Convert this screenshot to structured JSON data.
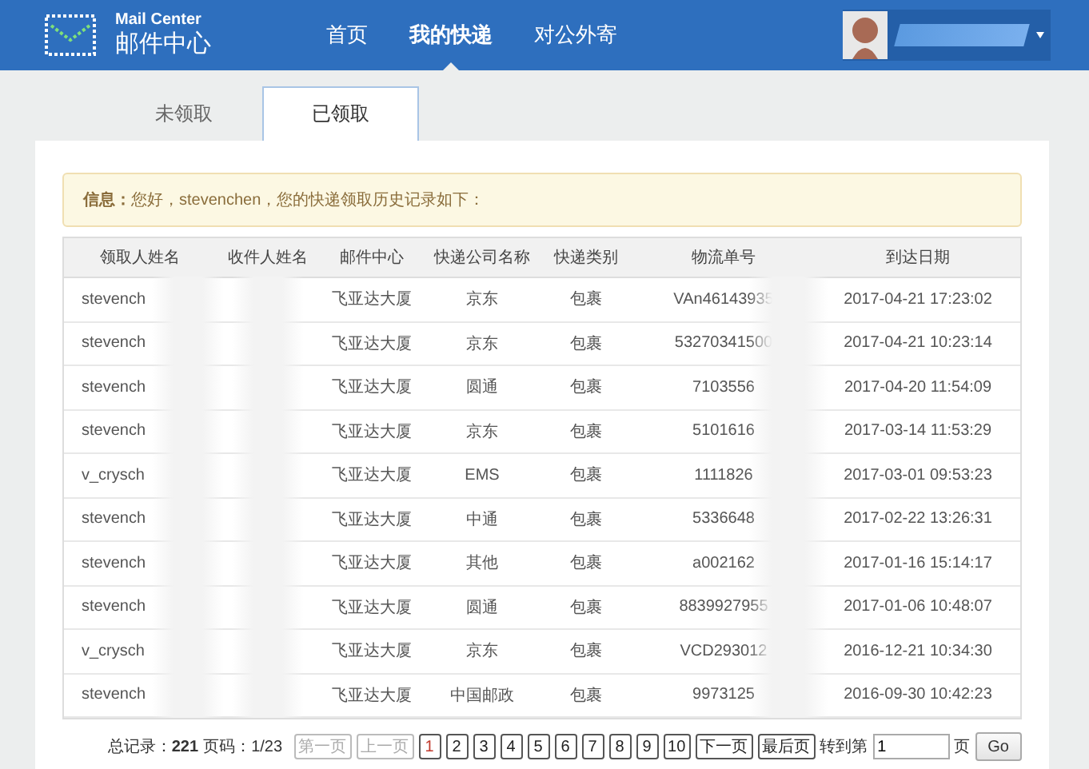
{
  "logo": {
    "title": "Mail Center",
    "subtitle": "邮件中心"
  },
  "nav": [
    {
      "label": "首页",
      "selected": false
    },
    {
      "label": "我的快递",
      "selected": true
    },
    {
      "label": "对公外寄",
      "selected": false
    }
  ],
  "tabs": [
    {
      "label": "未领取",
      "selected": false
    },
    {
      "label": "已领取",
      "selected": true
    }
  ],
  "info": {
    "label": "信息：",
    "text": "您好，stevenchen，您的快递领取历史记录如下："
  },
  "table": {
    "columns": [
      "领取人姓名",
      "收件人姓名",
      "邮件中心",
      "快递公司名称",
      "快递类别",
      "物流单号",
      "到达日期"
    ],
    "rows": [
      [
        "stevench",
        "",
        "飞亚达大厦",
        "京东",
        "包裹",
        "VAn46143935",
        "2017-04-21 17:23:02"
      ],
      [
        "stevench",
        "",
        "飞亚达大厦",
        "京东",
        "包裹",
        "53270341500",
        "2017-04-21 10:23:14"
      ],
      [
        "stevench",
        "",
        "飞亚达大厦",
        "圆通",
        "包裹",
        "7103556",
        "2017-04-20 11:54:09"
      ],
      [
        "stevench",
        "",
        "飞亚达大厦",
        "京东",
        "包裹",
        "5101616",
        "2017-03-14 11:53:29"
      ],
      [
        "v_crysch",
        "",
        "飞亚达大厦",
        "EMS",
        "包裹",
        "1111826",
        "2017-03-01 09:53:23"
      ],
      [
        "stevench",
        "",
        "飞亚达大厦",
        "中通",
        "包裹",
        "5336648",
        "2017-02-22 13:26:31"
      ],
      [
        "stevench",
        "",
        "飞亚达大厦",
        "其他",
        "包裹",
        "a002162",
        "2017-01-16 15:14:17"
      ],
      [
        "stevench",
        "",
        "飞亚达大厦",
        "圆通",
        "包裹",
        "8839927955",
        "2017-01-06 10:48:07"
      ],
      [
        "v_crysch",
        "",
        "飞亚达大厦",
        "京东",
        "包裹",
        "VCD293012",
        "2016-12-21 10:34:30"
      ],
      [
        "stevench",
        "",
        "飞亚达大厦",
        "中国邮政",
        "包裹",
        "9973125",
        "2016-09-30 10:42:23"
      ]
    ]
  },
  "pagination": {
    "total_label": "总记录：",
    "total": "221",
    "page_info": "页码：1/23",
    "buttons": [
      {
        "label": "第一页",
        "disabled": true,
        "selected": false
      },
      {
        "label": "上一页",
        "disabled": true,
        "selected": false
      },
      {
        "label": "1",
        "disabled": false,
        "selected": true
      },
      {
        "label": "2",
        "disabled": false,
        "selected": false
      },
      {
        "label": "3",
        "disabled": false,
        "selected": false
      },
      {
        "label": "4",
        "disabled": false,
        "selected": false
      },
      {
        "label": "5",
        "disabled": false,
        "selected": false
      },
      {
        "label": "6",
        "disabled": false,
        "selected": false
      },
      {
        "label": "7",
        "disabled": false,
        "selected": false
      },
      {
        "label": "8",
        "disabled": false,
        "selected": false
      },
      {
        "label": "9",
        "disabled": false,
        "selected": false
      },
      {
        "label": "10",
        "disabled": false,
        "selected": false
      },
      {
        "label": "下一页",
        "disabled": false,
        "selected": false
      },
      {
        "label": "最后页",
        "disabled": false,
        "selected": false
      }
    ],
    "goto_label": "转到第",
    "goto_value": "1",
    "goto_suffix": "页",
    "go": "Go"
  }
}
